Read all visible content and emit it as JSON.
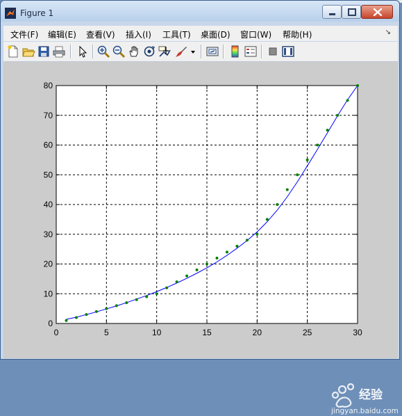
{
  "window": {
    "title": "Figure 1",
    "title_icon": "matlab-logo-icon"
  },
  "window_controls": {
    "minimize_icon": "minimize-icon",
    "maximize_icon": "maximize-icon",
    "close_icon": "close-icon"
  },
  "menu": {
    "items": [
      {
        "label": "文件(F)"
      },
      {
        "label": "编辑(E)"
      },
      {
        "label": "查看(V)"
      },
      {
        "label": "插入(I)"
      },
      {
        "label": "工具(T)"
      },
      {
        "label": "桌面(D)"
      },
      {
        "label": "窗口(W)"
      },
      {
        "label": "帮助(H)"
      }
    ],
    "overflow_icon": "menu-overflow-arrow-icon"
  },
  "toolbar": {
    "icons": [
      "new-figure-icon",
      "open-file-icon",
      "save-icon",
      "print-icon",
      "edit-plot-arrow-icon",
      "zoom-in-icon",
      "zoom-out-icon",
      "pan-hand-icon",
      "rotate-3d-icon",
      "data-cursor-icon",
      "brush-icon",
      "brush-dropdown-icon",
      "link-plot-icon",
      "colorbar-icon",
      "legend-icon",
      "hide-plot-tools-icon",
      "show-plot-tools-icon"
    ]
  },
  "colors": {
    "figure_bg": "#cccccc",
    "axes_bg": "#ffffff",
    "line": "#0000ff",
    "markers": "#008000"
  },
  "chart_data": {
    "type": "line",
    "title": "",
    "xlabel": "",
    "ylabel": "",
    "xlim": [
      0,
      30
    ],
    "ylim": [
      0,
      80
    ],
    "xticks": [
      0,
      5,
      10,
      15,
      20,
      25,
      30
    ],
    "yticks": [
      0,
      10,
      20,
      30,
      40,
      50,
      60,
      70,
      80
    ],
    "grid": true,
    "grid_style": "dashed",
    "legend": "none",
    "series": [
      {
        "style": "markers",
        "marker": "dot",
        "color": "#008000",
        "x": [
          1,
          2,
          3,
          4,
          5,
          6,
          7,
          8,
          9,
          10,
          11,
          12,
          13,
          14,
          15,
          16,
          17,
          18,
          19,
          20,
          21,
          22,
          23,
          24,
          25,
          26,
          27,
          28,
          29,
          30
        ],
        "y": [
          1,
          2,
          3,
          4,
          5,
          6,
          7,
          8,
          9,
          10,
          12,
          14,
          16,
          18,
          20,
          22,
          24,
          26,
          28,
          30,
          35,
          40,
          45,
          50,
          55,
          60,
          65,
          70,
          75,
          80
        ]
      },
      {
        "style": "line",
        "color": "#0000ff",
        "x": [
          1,
          2,
          3,
          4,
          5,
          6,
          7,
          8,
          9,
          10,
          11,
          12,
          13,
          14,
          15,
          16,
          17,
          18,
          19,
          20,
          21,
          22,
          23,
          24,
          25,
          26,
          27,
          28,
          29,
          30
        ],
        "y": [
          1.4,
          2.1,
          3.0,
          3.9,
          4.9,
          5.9,
          7.0,
          8.2,
          9.4,
          10.7,
          12.1,
          13.6,
          15.2,
          16.9,
          18.7,
          20.7,
          22.9,
          25.3,
          27.9,
          30.8,
          34.2,
          38.1,
          42.6,
          47.6,
          53.0,
          58.5,
          64.1,
          69.8,
          75.2,
          80.0
        ]
      }
    ]
  },
  "watermark": {
    "text": "jingyan.baidu.com",
    "brand": "经验"
  }
}
